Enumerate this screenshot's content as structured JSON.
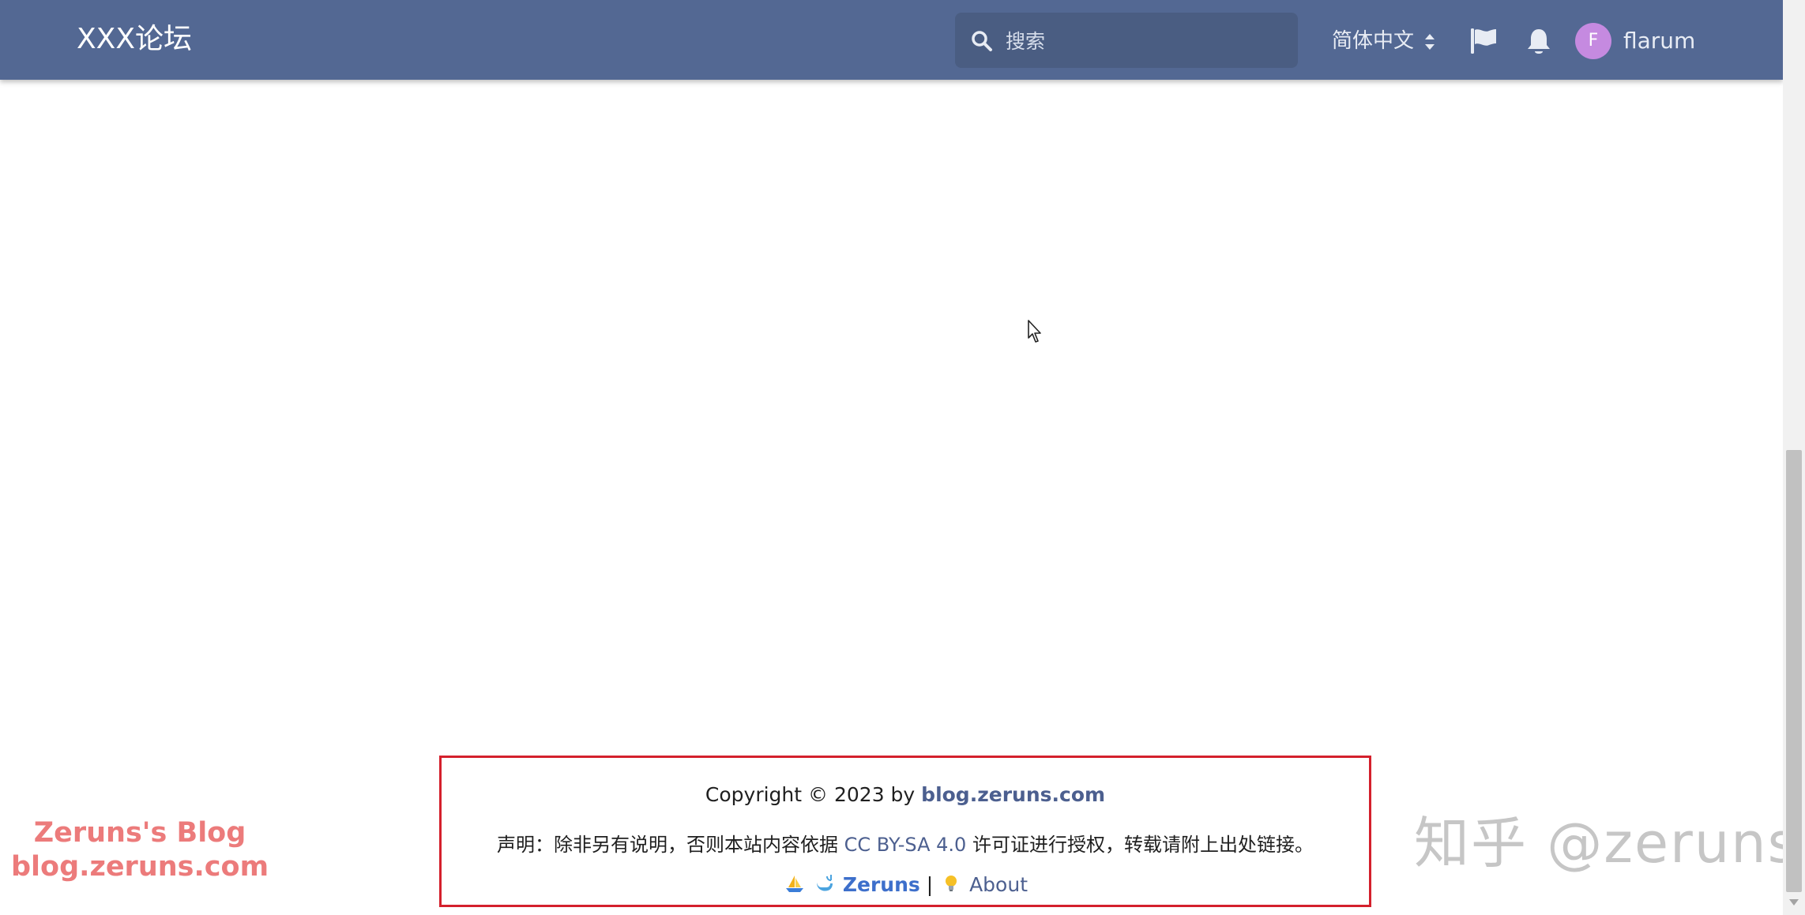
{
  "header": {
    "brand": "XXX论坛",
    "search": {
      "placeholder": "搜索",
      "icon": "search-icon"
    },
    "language": {
      "label": "简体中文",
      "icon": "updown-caret-icon"
    },
    "flag_icon": "flag-icon",
    "notifications_icon": "bell-icon",
    "user": {
      "avatar_letter": "F",
      "avatar_color": "#c58ae0",
      "name": "flarum"
    },
    "bar_color": "#536893"
  },
  "footer": {
    "copyright_prefix": "Copyright © 2023 by",
    "copyright_link": "blog.zeruns.com",
    "statement_prefix": "声明：除非另有说明，否则本站内容依据",
    "statement_license": "CC BY-SA 4.0",
    "statement_suffix": "许可证进行授权，转载请附上出处链接。",
    "nav_link_1": "Zeruns",
    "separator": "|",
    "nav_link_2": "About",
    "border_color": "#d4202c"
  },
  "watermarks": {
    "left_line1": "Zeruns's Blog",
    "left_line2": "blog.zeruns.com",
    "right": "知乎 @zeruns"
  }
}
